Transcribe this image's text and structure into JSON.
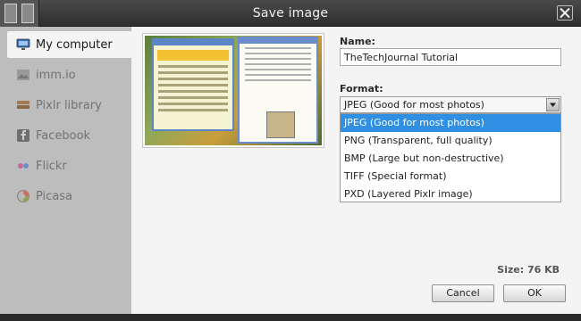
{
  "window": {
    "title": "Save image"
  },
  "sidebar": {
    "items": [
      {
        "label": "My computer",
        "icon": "monitor-icon",
        "active": true
      },
      {
        "label": "imm.io",
        "icon": "image-icon",
        "active": false
      },
      {
        "label": "Pixlr library",
        "icon": "library-icon",
        "active": false
      },
      {
        "label": "Facebook",
        "icon": "facebook-icon",
        "active": false
      },
      {
        "label": "Flickr",
        "icon": "flickr-icon",
        "active": false
      },
      {
        "label": "Picasa",
        "icon": "picasa-icon",
        "active": false
      }
    ]
  },
  "form": {
    "name_label": "Name:",
    "name_value": "TheTechJournal Tutorial",
    "format_label": "Format:",
    "format_selected": "JPEG (Good for most photos)",
    "format_options": [
      "JPEG (Good for most photos)",
      "PNG (Transparent, full quality)",
      "BMP (Large but non-destructive)",
      "TIFF (Special format)",
      "PXD (Layered Pixlr image)"
    ],
    "size_text": "Size: 76 KB"
  },
  "buttons": {
    "cancel": "Cancel",
    "ok": "OK"
  },
  "colors": {
    "selected_option": "#2e8fe3",
    "sidebar_bg": "#bdbdbd",
    "panel_bg": "#f4f4f4",
    "titlebar_bg": "#3a3a3a"
  }
}
